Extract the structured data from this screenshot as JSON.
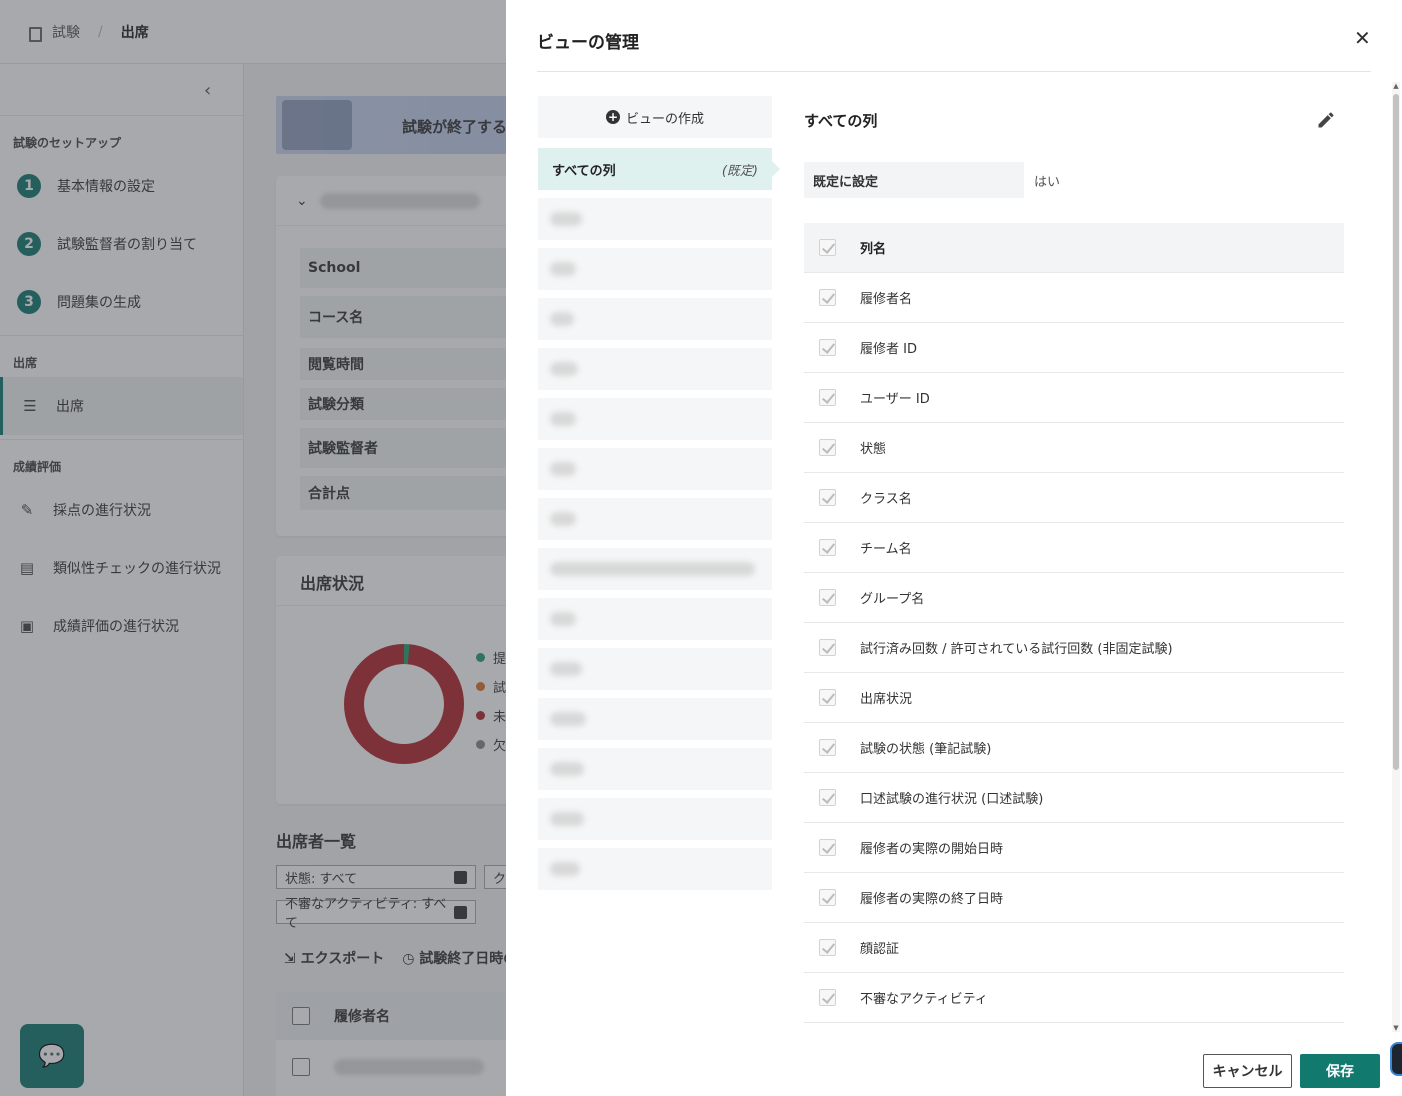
{
  "breadcrumb": {
    "parent": "試験",
    "current": "出席"
  },
  "sidebar": {
    "collapse_glyph": "‹",
    "setup_heading": "試験のセットアップ",
    "setup_items": [
      {
        "num": "1",
        "label": "基本情報の設定"
      },
      {
        "num": "2",
        "label": "試験監督者の割り当て"
      },
      {
        "num": "3",
        "label": "問題集の生成"
      }
    ],
    "attendance_heading": "出席",
    "attendance_item": "出席",
    "grading_heading": "成績評価",
    "grading_items": [
      {
        "icon": "pencil-icon",
        "label": "採点の進行状況"
      },
      {
        "icon": "clipboard-icon",
        "label": "類似性チェックの進行状況"
      },
      {
        "icon": "document-icon",
        "label": "成績評価の進行状況"
      }
    ]
  },
  "main": {
    "banner_text": "試験が終了する",
    "info_labels": [
      "School",
      "コース名",
      "閲覧時間",
      "試験分類",
      "試験監督者",
      "合計点"
    ],
    "attendance_title": "出席状況",
    "legend": [
      {
        "label": "提",
        "color": "#2a9d6e"
      },
      {
        "label": "試",
        "color": "#d8742b"
      },
      {
        "label": "未",
        "color": "#b3262d"
      },
      {
        "label": "欠",
        "color": "#888888"
      }
    ],
    "attendance_chart": {
      "segments": [
        {
          "color": "#2a9d6e",
          "fraction": 0.015
        },
        {
          "color": "#b3262d",
          "fraction": 0.985
        }
      ]
    },
    "list_title": "出席者一覧",
    "filters": {
      "status": "状態: すべて",
      "class_partial": "ク",
      "suspicious": "不審なアクティビティ: すべて"
    },
    "export_label": "エクスポート",
    "end_time_label": "試験終了日時の",
    "table_header": "履修者名"
  },
  "drawer": {
    "title": "ビューの管理",
    "close_glyph": "✕",
    "create_view_label": "ビューの作成",
    "selected_view": {
      "name": "すべての列",
      "default_tag": "(既定)"
    },
    "detail": {
      "title": "すべての列",
      "default_label": "既定に設定",
      "default_value": "はい",
      "column_header": "列名",
      "columns": [
        "履修者名",
        "履修者 ID",
        "ユーザー ID",
        "状態",
        "クラス名",
        "チーム名",
        "グループ名",
        "試行済み回数 / 許可されている試行回数 (非固定試験)",
        "出席状況",
        "試験の状態 (筆記試験)",
        "口述試験の進行状況 (口述試験)",
        "履修者の実際の開始日時",
        "履修者の実際の終了日時",
        "顔認証",
        "不審なアクティビティ"
      ]
    },
    "cancel_label": "キャンセル",
    "save_label": "保存"
  },
  "colors": {
    "accent": "#12796f",
    "selected_view_bg": "#def1ee",
    "overlay": "rgba(60,64,70,.45)"
  }
}
